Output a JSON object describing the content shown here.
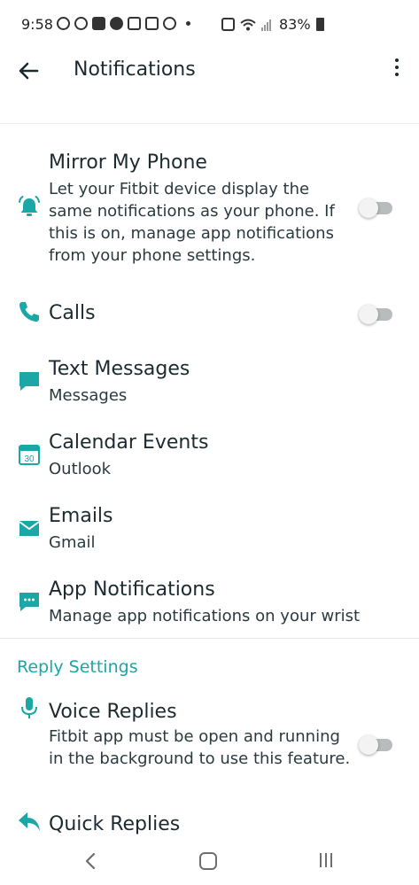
{
  "status_bar": {
    "time": "9:58",
    "battery": "83%"
  },
  "app_bar": {
    "title": "Notifications"
  },
  "colors": {
    "accent": "#1aa7a6",
    "toggle_off": "#b9bcbd"
  },
  "items": {
    "mirror": {
      "title": "Mirror My Phone",
      "subtitle": "Let your Fitbit device display the same notifications as your phone. If this is on, manage app notifications from your phone settings.",
      "icon": "bell-icon",
      "toggle": false
    },
    "calls": {
      "title": "Calls",
      "icon": "phone-icon",
      "toggle": false
    },
    "texts": {
      "title": "Text Messages",
      "subtitle": "Messages",
      "icon": "message-icon"
    },
    "calendar": {
      "title": "Calendar Events",
      "subtitle": "Outlook",
      "icon": "calendar-icon",
      "icon_text": "30"
    },
    "emails": {
      "title": "Emails",
      "subtitle": "Gmail",
      "icon": "mail-icon"
    },
    "app_notifications": {
      "title": "App Notifications",
      "subtitle": "Manage app notifications on your wrist",
      "icon": "app-notification-icon"
    }
  },
  "reply_settings": {
    "header": "Reply Settings",
    "voice": {
      "title": "Voice Replies",
      "subtitle": "Fitbit app must be open and running in the background to use this feature.",
      "icon": "microphone-icon",
      "toggle": false
    },
    "quick": {
      "title": "Quick Replies",
      "icon": "reply-icon"
    }
  }
}
